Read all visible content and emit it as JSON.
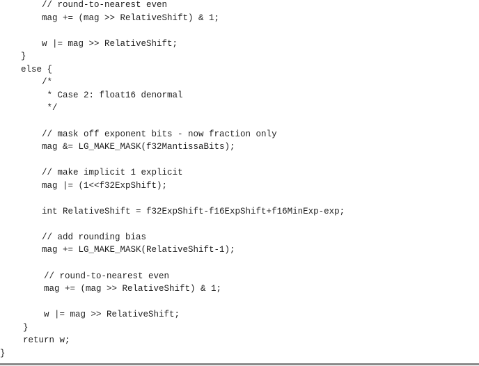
{
  "code_lines": [
    "        // round-to-nearest even",
    "        mag += (mag >> RelativeShift) & 1;",
    "",
    "        w |= mag >> RelativeShift;",
    "    }",
    "    else {",
    "        /*",
    "         * Case 2: float16 denormal",
    "         */",
    "",
    "        // mask off exponent bits - now fraction only",
    "        mag &= LG_MAKE_MASK(f32MantissaBits);",
    "",
    "        // make implicit 1 explicit",
    "        mag |= (1<<f32ExpShift);",
    "",
    "        int RelativeShift = f32ExpShift-f16ExpShift+f16MinExp-exp;",
    "",
    "        // add rounding bias",
    "        mag += LG_MAKE_MASK(RelativeShift-1);",
    "",
    "        // round-to-nearest even",
    "        mag += (mag >> RelativeShift) & 1;",
    "",
    "        w |= mag >> RelativeShift;",
    "    }",
    "    return w;",
    "}"
  ]
}
